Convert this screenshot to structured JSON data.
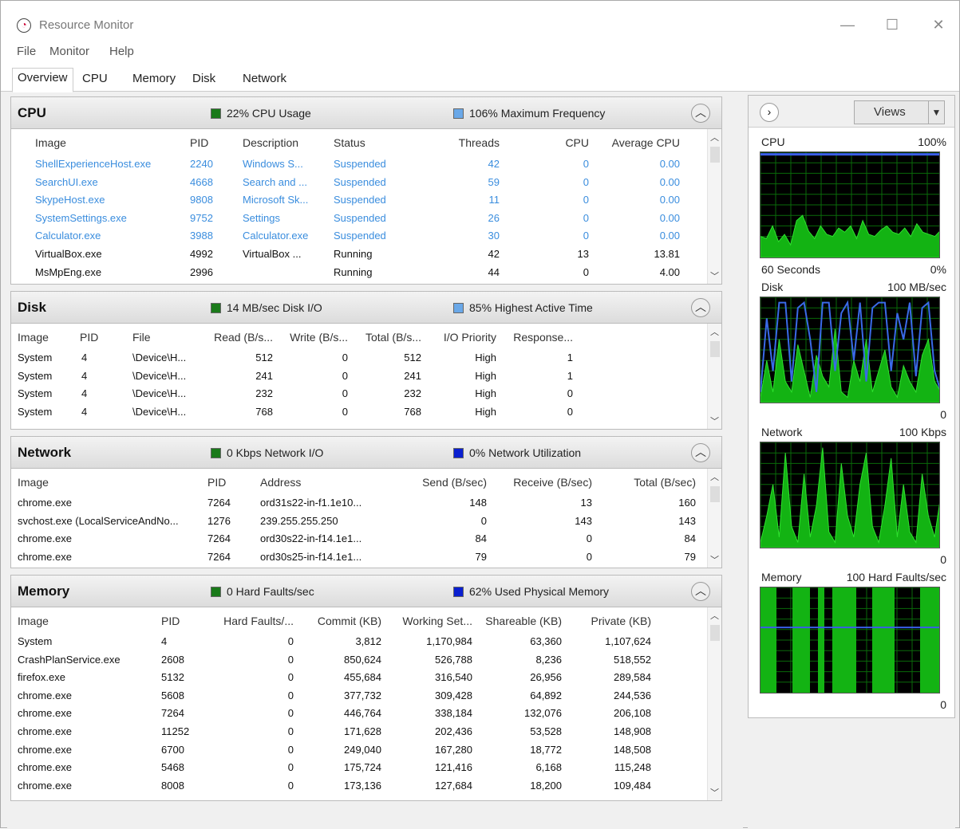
{
  "window": {
    "title": "Resource Monitor",
    "minimize": "—",
    "maximize": "☐",
    "close": "✕"
  },
  "menu": [
    "File",
    "Monitor",
    "Help"
  ],
  "tabs": [
    "Overview",
    "CPU",
    "Memory",
    "Disk",
    "Network"
  ],
  "colors": {
    "green": "#1a7a1a",
    "blue_sq": "#6aa8e8",
    "darkblue_sq": "#0a1fd0",
    "link": "#3a8dde"
  },
  "cpu": {
    "title": "CPU",
    "legend1": "22% CPU Usage",
    "legend2": "106% Maximum Frequency",
    "columns": [
      "Image",
      "PID",
      "Description",
      "Status",
      "Threads",
      "CPU",
      "Average CPU"
    ],
    "rows": [
      [
        "ShellExperienceHost.exe",
        "2240",
        "Windows S...",
        "Suspended",
        "42",
        "0",
        "0.00"
      ],
      [
        "SearchUI.exe",
        "4668",
        "Search and ...",
        "Suspended",
        "59",
        "0",
        "0.00"
      ],
      [
        "SkypeHost.exe",
        "9808",
        "Microsoft Sk...",
        "Suspended",
        "11",
        "0",
        "0.00"
      ],
      [
        "SystemSettings.exe",
        "9752",
        "Settings",
        "Suspended",
        "26",
        "0",
        "0.00"
      ],
      [
        "Calculator.exe",
        "3988",
        "Calculator.exe",
        "Suspended",
        "30",
        "0",
        "0.00"
      ],
      [
        "VirtualBox.exe",
        "4992",
        "VirtualBox ...",
        "Running",
        "42",
        "13",
        "13.81"
      ],
      [
        "MsMpEng.exe",
        "2996",
        "",
        "Running",
        "44",
        "0",
        "4.00"
      ]
    ]
  },
  "disk": {
    "title": "Disk",
    "legend1": "14 MB/sec Disk I/O",
    "legend2": "85% Highest Active Time",
    "columns": [
      "Image",
      "PID",
      "File",
      "Read (B/s...",
      "Write (B/s...",
      "Total (B/s...",
      "I/O Priority",
      "Response..."
    ],
    "rows": [
      [
        "System",
        "4",
        "\\Device\\H...",
        "512",
        "0",
        "512",
        "High",
        "1"
      ],
      [
        "System",
        "4",
        "\\Device\\H...",
        "241",
        "0",
        "241",
        "High",
        "1"
      ],
      [
        "System",
        "4",
        "\\Device\\H...",
        "232",
        "0",
        "232",
        "High",
        "0"
      ],
      [
        "System",
        "4",
        "\\Device\\H...",
        "768",
        "0",
        "768",
        "High",
        "0"
      ]
    ]
  },
  "network": {
    "title": "Network",
    "legend1": "0 Kbps Network I/O",
    "legend2": "0% Network Utilization",
    "columns": [
      "Image",
      "PID",
      "Address",
      "Send (B/sec)",
      "Receive (B/sec)",
      "Total (B/sec)"
    ],
    "rows": [
      [
        "chrome.exe",
        "7264",
        "ord31s22-in-f1.1e10...",
        "148",
        "13",
        "160"
      ],
      [
        "svchost.exe (LocalServiceAndNo...",
        "1276",
        "239.255.255.250",
        "0",
        "143",
        "143"
      ],
      [
        "chrome.exe",
        "7264",
        "ord30s22-in-f14.1e1...",
        "84",
        "0",
        "84"
      ],
      [
        "chrome.exe",
        "7264",
        "ord30s25-in-f14.1e1...",
        "79",
        "0",
        "79"
      ]
    ]
  },
  "memory": {
    "title": "Memory",
    "legend1": "0 Hard Faults/sec",
    "legend2": "62% Used Physical Memory",
    "columns": [
      "Image",
      "PID",
      "Hard Faults/...",
      "Commit (KB)",
      "Working Set...",
      "Shareable (KB)",
      "Private (KB)"
    ],
    "rows": [
      [
        "System",
        "4",
        "0",
        "3,812",
        "1,170,984",
        "63,360",
        "1,107,624"
      ],
      [
        "CrashPlanService.exe",
        "2608",
        "0",
        "850,624",
        "526,788",
        "8,236",
        "518,552"
      ],
      [
        "firefox.exe",
        "5132",
        "0",
        "455,684",
        "316,540",
        "26,956",
        "289,584"
      ],
      [
        "chrome.exe",
        "5608",
        "0",
        "377,732",
        "309,428",
        "64,892",
        "244,536"
      ],
      [
        "chrome.exe",
        "7264",
        "0",
        "446,764",
        "338,184",
        "132,076",
        "206,108"
      ],
      [
        "chrome.exe",
        "11252",
        "0",
        "171,628",
        "202,436",
        "53,528",
        "148,908"
      ],
      [
        "chrome.exe",
        "6700",
        "0",
        "249,040",
        "167,280",
        "18,772",
        "148,508"
      ],
      [
        "chrome.exe",
        "5468",
        "0",
        "175,724",
        "121,416",
        "6,168",
        "115,248"
      ],
      [
        "chrome.exe",
        "8008",
        "0",
        "173,136",
        "127,684",
        "18,200",
        "109,484"
      ]
    ]
  },
  "side": {
    "views": "Views",
    "cpu_label": "CPU",
    "cpu_max": "100%",
    "cpu_time": "60 Seconds",
    "cpu_min": "0%",
    "disk_label": "Disk",
    "disk_max": "100 MB/sec",
    "disk_min": "0",
    "net_label": "Network",
    "net_max": "100 Kbps",
    "net_min": "0",
    "mem_label": "Memory",
    "mem_max": "100 Hard Faults/sec",
    "mem_min": "0"
  }
}
